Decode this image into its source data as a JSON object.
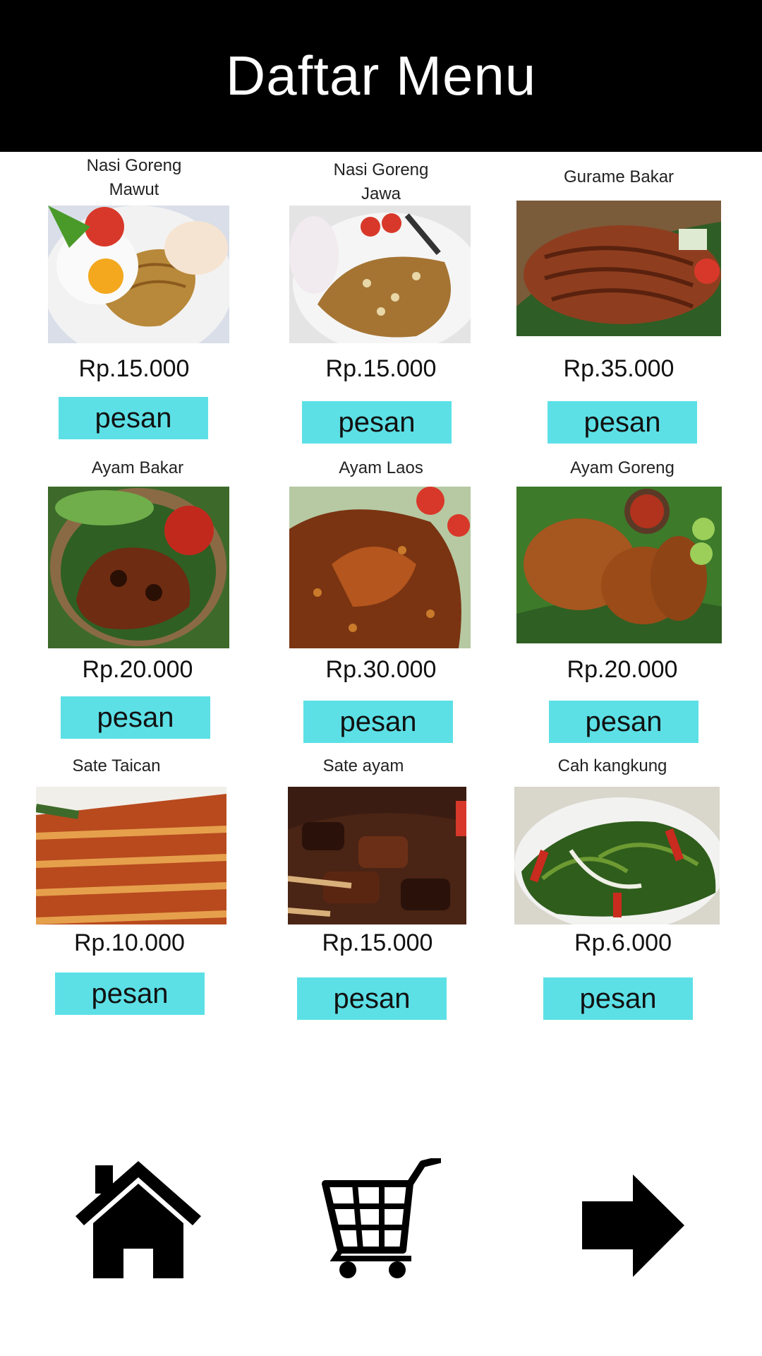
{
  "header": {
    "title": "Daftar Menu"
  },
  "menu": [
    {
      "name": "Nasi Goreng\nMawut",
      "price": "Rp.15.000",
      "button": "pesan",
      "photo_icon": "fried-noodle-egg"
    },
    {
      "name": "Nasi Goreng\nJawa",
      "price": "Rp.15.000",
      "button": "pesan",
      "photo_icon": "fried-rice"
    },
    {
      "name": "Gurame Bakar",
      "price": "Rp.35.000",
      "button": "pesan",
      "photo_icon": "grilled-fish"
    },
    {
      "name": "Ayam Bakar",
      "price": "Rp.20.000",
      "button": "pesan",
      "photo_icon": "grilled-chicken"
    },
    {
      "name": "Ayam Laos",
      "price": "Rp.30.000",
      "button": "pesan",
      "photo_icon": "galangal-chicken"
    },
    {
      "name": "Ayam Goreng",
      "price": "Rp.20.000",
      "button": "pesan",
      "photo_icon": "fried-chicken"
    },
    {
      "name": "Sate Taican",
      "price": "Rp.10.000",
      "button": "pesan",
      "photo_icon": "chicken-satay"
    },
    {
      "name": "Sate ayam",
      "price": "Rp.15.000",
      "button": "pesan",
      "photo_icon": "satay"
    },
    {
      "name": "Cah kangkung",
      "price": "Rp.6.000",
      "button": "pesan",
      "photo_icon": "stir-fried-greens"
    }
  ],
  "bottom_nav": [
    {
      "icon": "home-icon"
    },
    {
      "icon": "cart-icon"
    },
    {
      "icon": "arrow-right-icon"
    }
  ],
  "colors": {
    "header_bg": "#000000",
    "button_bg": "#5ce0e6",
    "text": "#111111"
  }
}
